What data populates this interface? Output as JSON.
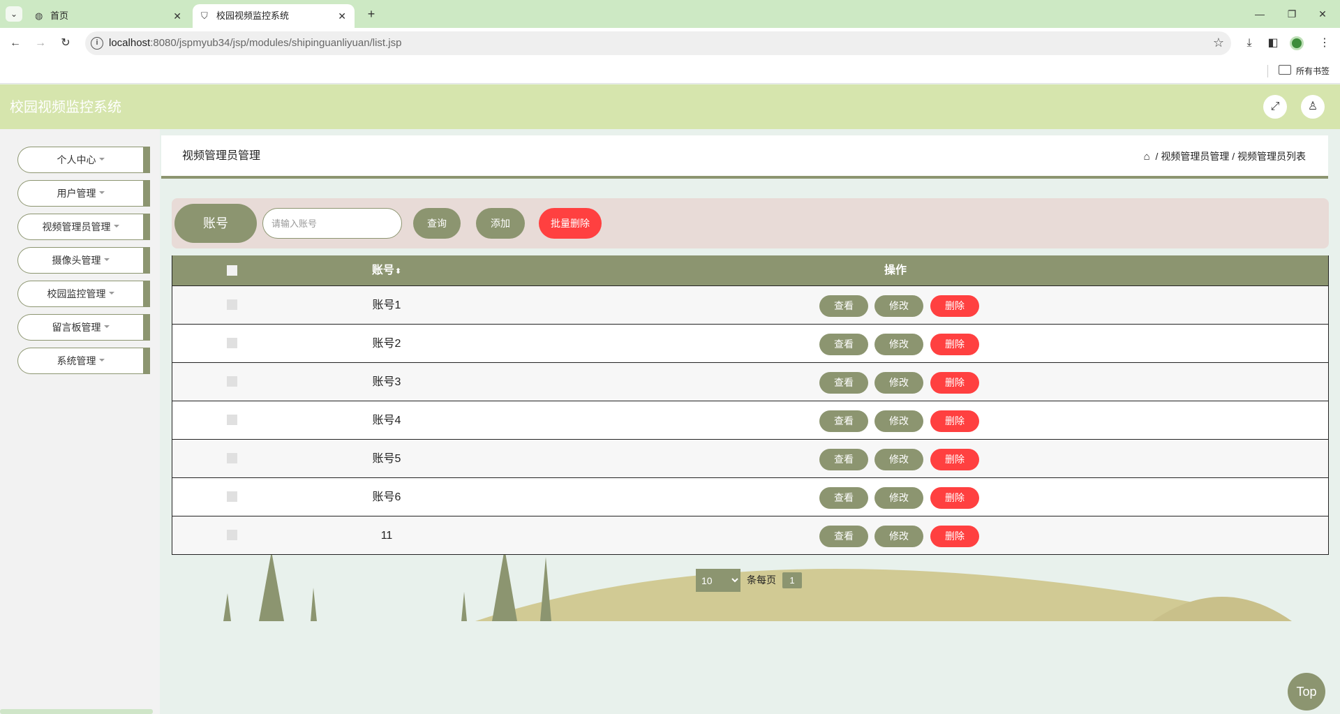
{
  "browser": {
    "tabs": [
      {
        "title": "首页",
        "active": false
      },
      {
        "title": "校园视频监控系统",
        "active": true
      }
    ],
    "url_host": "localhost",
    "url_rest": ":8080/jspmyub34/jsp/modules/shipinguanliyuan/list.jsp",
    "bookmarks_label": "所有书签"
  },
  "app": {
    "title": "校园视频监控系统",
    "colors": {
      "accent": "#8c9570",
      "header": "#d6e5ad",
      "danger": "#ff4040"
    }
  },
  "sidebar": {
    "items": [
      {
        "label": "个人中心"
      },
      {
        "label": "用户管理"
      },
      {
        "label": "视频管理员管理"
      },
      {
        "label": "摄像头管理"
      },
      {
        "label": "校园监控管理"
      },
      {
        "label": "留言板管理"
      },
      {
        "label": "系统管理"
      }
    ]
  },
  "panel": {
    "title": "视频管理员管理",
    "breadcrumb": [
      "视频管理员管理",
      "视频管理员列表"
    ]
  },
  "search": {
    "label": "账号",
    "placeholder": "请输入账号",
    "query_label": "查询",
    "add_label": "添加",
    "batch_delete_label": "批量删除"
  },
  "table": {
    "headers": {
      "account": "账号",
      "sort_glyph": "⬍",
      "actions": "操作"
    },
    "rows": [
      {
        "account": "账号1"
      },
      {
        "account": "账号2"
      },
      {
        "account": "账号3"
      },
      {
        "account": "账号4"
      },
      {
        "account": "账号5"
      },
      {
        "account": "账号6"
      },
      {
        "account": "11"
      }
    ],
    "row_actions": {
      "view": "查看",
      "edit": "修改",
      "delete": "删除"
    }
  },
  "pagination": {
    "page_size": "10",
    "per_page_label": "条每页",
    "current_page": "1"
  },
  "top_button": "Top"
}
